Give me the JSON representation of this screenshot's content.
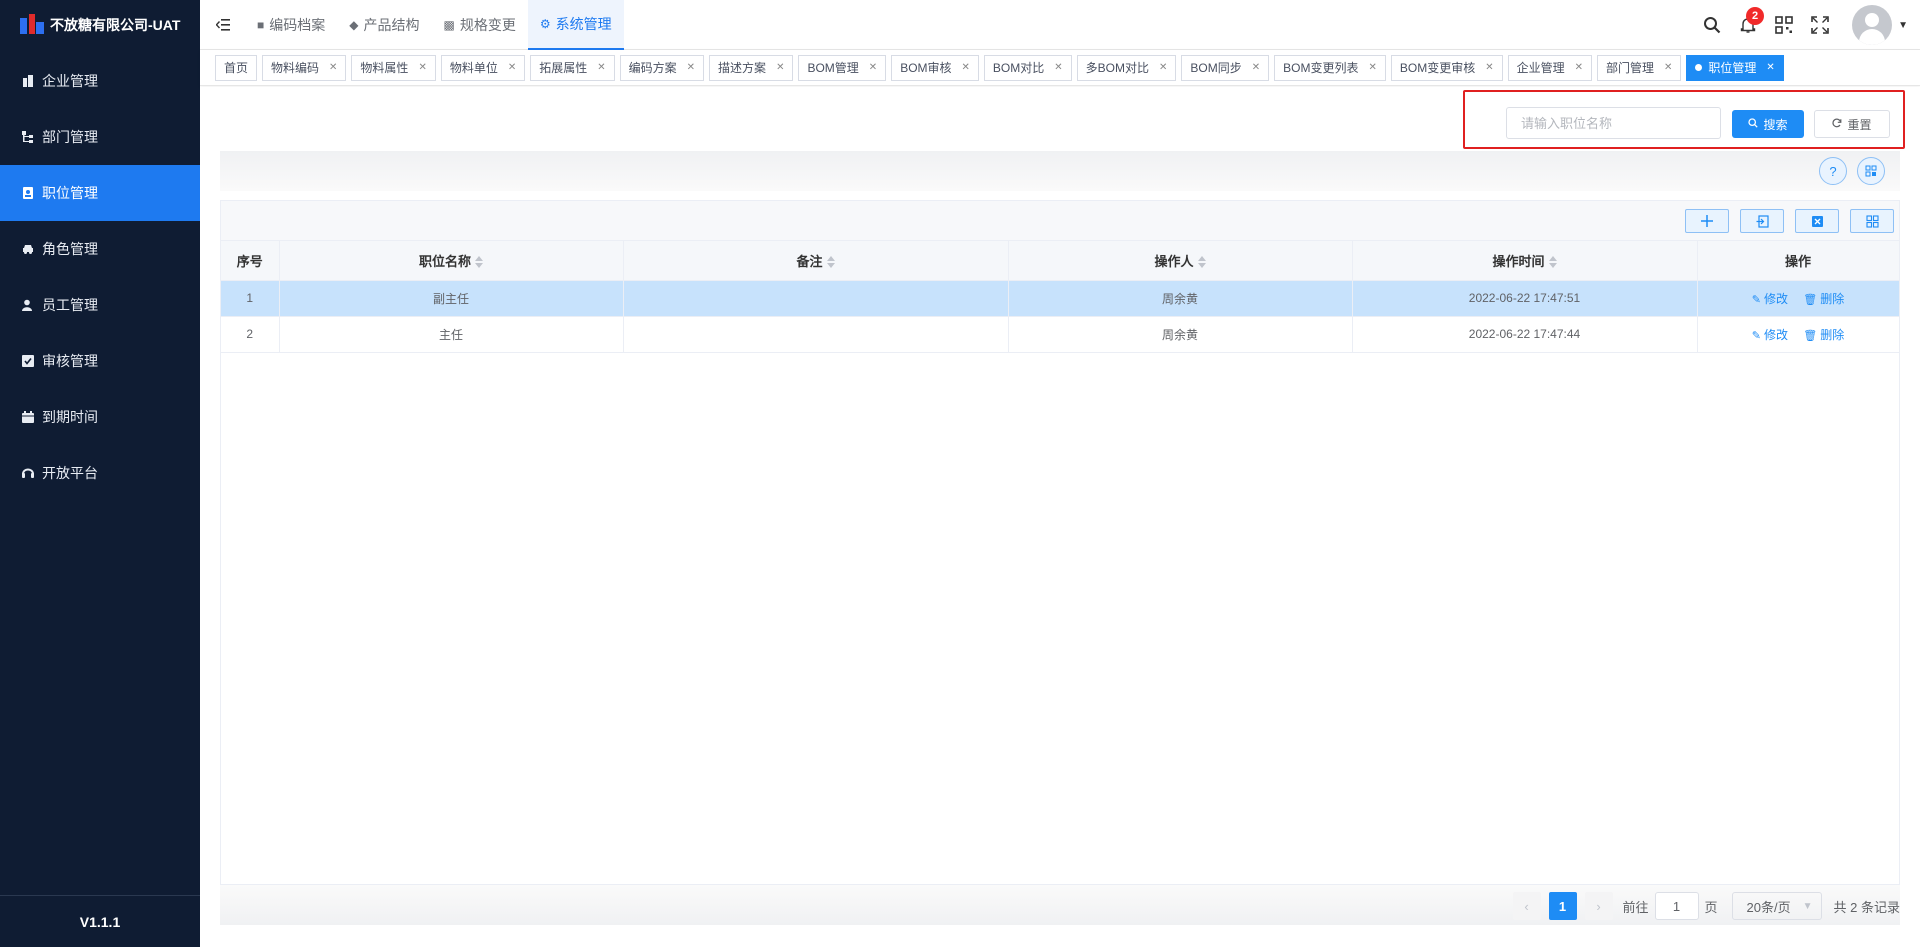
{
  "app": {
    "title": "不放糖有限公司-UAT",
    "version": "V1.1.1"
  },
  "sidebar": {
    "items": [
      {
        "label": "企业管理",
        "icon": "building-icon"
      },
      {
        "label": "部门管理",
        "icon": "tree-icon"
      },
      {
        "label": "职位管理",
        "icon": "badge-icon",
        "active": true
      },
      {
        "label": "角色管理",
        "icon": "car-icon"
      },
      {
        "label": "员工管理",
        "icon": "user-icon"
      },
      {
        "label": "审核管理",
        "icon": "check-icon"
      },
      {
        "label": "到期时间",
        "icon": "calendar-icon"
      },
      {
        "label": "开放平台",
        "icon": "headset-icon"
      }
    ]
  },
  "topnav": {
    "items": [
      {
        "label": "编码档案"
      },
      {
        "label": "产品结构"
      },
      {
        "label": "规格变更"
      },
      {
        "label": "系统管理",
        "active": true
      }
    ],
    "notification_count": "2"
  },
  "tabs": [
    "首页",
    "物料编码",
    "物料属性",
    "物料单位",
    "拓展属性",
    "编码方案",
    "描述方案",
    "BOM管理",
    "BOM审核",
    "BOM对比",
    "多BOM对比",
    "BOM同步",
    "BOM变更列表",
    "BOM变更审核",
    "企业管理",
    "部门管理",
    "职位管理"
  ],
  "search": {
    "placeholder": "请输入职位名称",
    "value": "",
    "search_label": "搜索",
    "reset_label": "重置"
  },
  "table": {
    "columns": [
      "序号",
      "职位名称",
      "备注",
      "操作人",
      "操作时间",
      "操作"
    ],
    "rows": [
      {
        "index": "1",
        "name": "副主任",
        "remark": "",
        "operator": "周余黄",
        "time": "2022-06-22 17:47:51"
      },
      {
        "index": "2",
        "name": "主任",
        "remark": "",
        "operator": "周余黄",
        "time": "2022-06-22 17:47:44"
      }
    ],
    "edit_label": "修改",
    "delete_label": "删除"
  },
  "pagination": {
    "current_page": "1",
    "goto_prefix": "前往",
    "goto_value": "1",
    "goto_suffix": "页",
    "page_size": "20条/页",
    "total": "共 2 条记录"
  },
  "colors": {
    "primary": "#1e8cf5",
    "sidebar_bg": "#0f1c33",
    "highlight": "#e02020"
  }
}
